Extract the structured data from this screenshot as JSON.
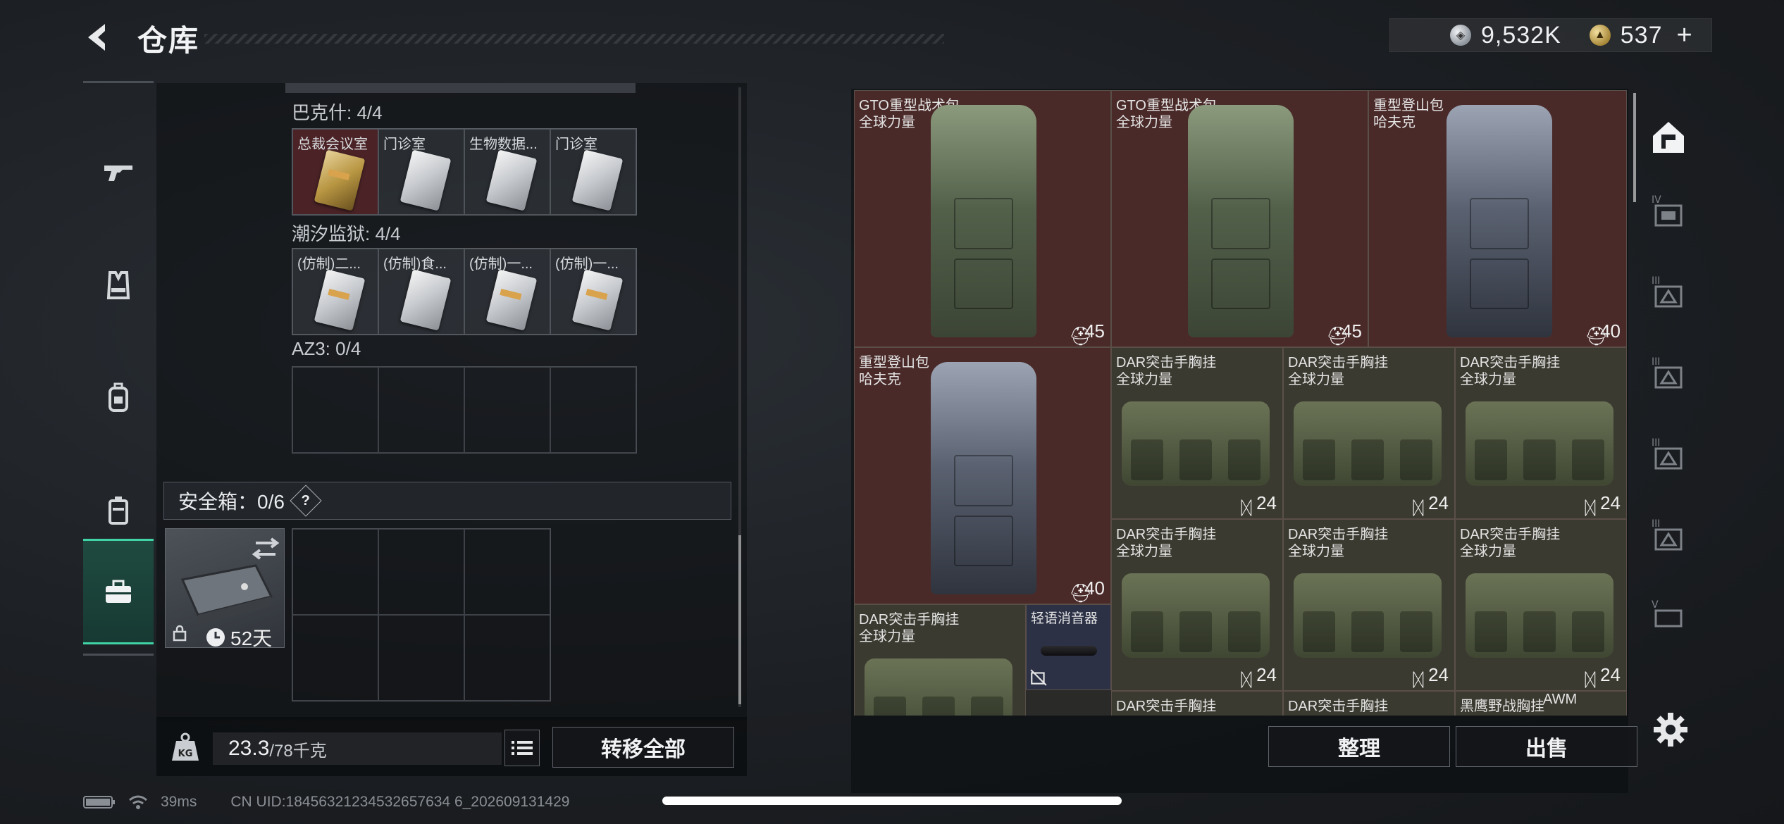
{
  "header": {
    "title": "仓库",
    "silver_amount": "9,532K",
    "gold_amount": "537",
    "gold_add": "+"
  },
  "nav": [
    {
      "name": "weapons",
      "icon": "gun-icon"
    },
    {
      "name": "armor",
      "icon": "vest-icon"
    },
    {
      "name": "backpacks",
      "icon": "backpack-icon"
    },
    {
      "name": "containers",
      "icon": "crate-icon"
    },
    {
      "name": "keys",
      "icon": "toolbox-icon",
      "active": true
    }
  ],
  "key_sections": [
    {
      "label": "巴克什: 4/4",
      "items": [
        {
          "name": "总裁会议室",
          "style": "gold",
          "bg": "red"
        },
        {
          "name": "门诊室",
          "style": "silver",
          "bg": "gray"
        },
        {
          "name": "生物数据...",
          "style": "silver",
          "bg": "gray"
        },
        {
          "name": "门诊室",
          "style": "silver",
          "bg": "gray"
        }
      ]
    },
    {
      "label": "潮汐监狱: 4/4",
      "items": [
        {
          "name": "(仿制)二...",
          "style": "silver",
          "bg": "gray"
        },
        {
          "name": "(仿制)食...",
          "style": "silver",
          "bg": "gray"
        },
        {
          "name": "(仿制)一...",
          "style": "silver",
          "bg": "gray"
        },
        {
          "name": "(仿制)一...",
          "style": "silver",
          "bg": "gray"
        }
      ]
    },
    {
      "label": "AZ3: 0/4",
      "items": []
    }
  ],
  "safe": {
    "label": "安全箱：0/6",
    "help": "?",
    "duration": "52天"
  },
  "weight": {
    "current": "23.3",
    "max": "/78千克",
    "transfer_label": "转移全部"
  },
  "inventory": [
    {
      "line1": "GTO重型战术包",
      "line2": "全球力量",
      "cap": "45",
      "kind": "bag-green",
      "bg": "red"
    },
    {
      "line1": "GTO重型战术包",
      "line2": "全球力量",
      "cap": "45",
      "kind": "bag-green",
      "bg": "red"
    },
    {
      "line1": "重型登山包",
      "line2": "哈夫克",
      "cap": "40",
      "kind": "bag-gray",
      "bg": "red"
    },
    {
      "line1": "重型登山包",
      "line2": "哈夫克",
      "cap": "40",
      "kind": "bag-gray",
      "bg": "red"
    },
    {
      "line1": "DAR突击手胸挂",
      "line2": "全球力量",
      "cap": "24",
      "kind": "vest",
      "bg": "olive"
    },
    {
      "line1": "DAR突击手胸挂",
      "line2": "全球力量",
      "cap": "24",
      "kind": "vest",
      "bg": "olive"
    },
    {
      "line1": "DAR突击手胸挂",
      "line2": "全球力量",
      "cap": "24",
      "kind": "vest",
      "bg": "olive"
    },
    {
      "line1": "DAR突击手胸挂",
      "line2": "全球力量",
      "cap": "24",
      "kind": "vest",
      "bg": "olive"
    },
    {
      "line1": "DAR突击手胸挂",
      "line2": "全球力量",
      "cap": "24",
      "kind": "vest",
      "bg": "olive"
    },
    {
      "line1": "DAR突击手胸挂",
      "line2": "全球力量",
      "cap": "24",
      "kind": "vest",
      "bg": "olive"
    },
    {
      "line1": "DAR突击手胸挂",
      "line2": "全球力量",
      "cap": "",
      "kind": "vest",
      "bg": "olive"
    },
    {
      "line1": "轻语消音器",
      "line2": "",
      "cap": "",
      "kind": "suppressor",
      "bg": "blue"
    },
    {
      "line1": "DAR突击手胸挂",
      "line2": "",
      "cap": "",
      "kind": "vest",
      "bg": "olive"
    },
    {
      "line1": "DAR突击手胸挂",
      "line2": "",
      "cap": "",
      "kind": "vest",
      "bg": "olive"
    },
    {
      "line1": "黑鹰野战胸挂",
      "line2": "",
      "cap": "",
      "kind": "vest",
      "bg": "olive"
    },
    {
      "line1": "AWM",
      "line2": "",
      "cap": "",
      "kind": "rifle",
      "bg": "red"
    }
  ],
  "actions": {
    "sort": "整理",
    "sell": "出售"
  },
  "categories": [
    "home-icon",
    "tier-4-icon",
    "tier-3-icon",
    "tier-3-icon",
    "tier-3-icon",
    "tier-3-icon",
    "tier-5-icon"
  ],
  "status": {
    "ping": "39ms",
    "uid": "CN UID:18456321234532657634 6_202609131429"
  }
}
